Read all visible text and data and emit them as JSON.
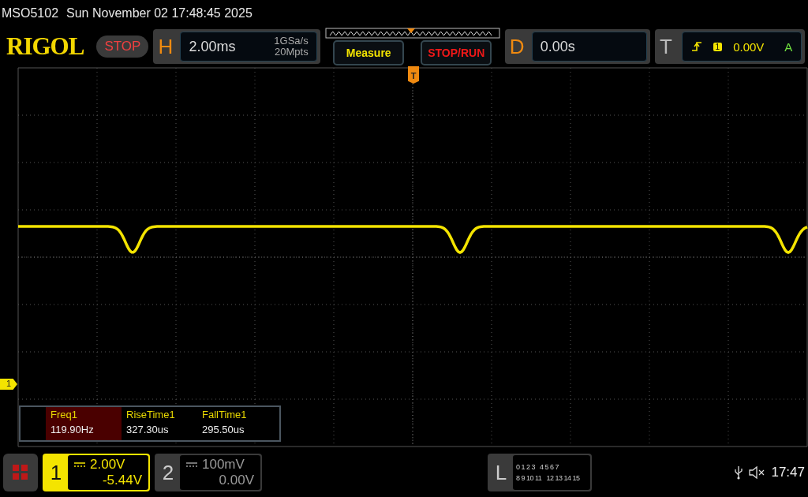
{
  "title": {
    "model": "MSO5102",
    "datetime": "Sun November 02 17:48:45 2025"
  },
  "header": {
    "logo": "RIGOL",
    "run_state": "STOP",
    "horizontal": {
      "letter": "H",
      "timebase": "2.00ms",
      "sample_rate": "1GSa/s",
      "memory_depth": "20Mpts"
    },
    "buttons": [
      {
        "label": "Measure",
        "kind": "measure"
      },
      {
        "label": "STOP/RUN",
        "kind": "stoprun"
      }
    ],
    "delay": {
      "letter": "D",
      "value": "0.00s"
    },
    "trigger": {
      "letter": "T",
      "channel": "1",
      "level": "0.00V",
      "mode": "A"
    }
  },
  "display": {
    "trigger_marker": "T",
    "channel_marker": "1"
  },
  "measurements": [
    {
      "name": "Freq1",
      "value": "119.90Hz",
      "selected": true
    },
    {
      "name": "RiseTime1",
      "value": "327.30us",
      "selected": false
    },
    {
      "name": "FallTime1",
      "value": "295.50us",
      "selected": false
    }
  ],
  "channels": [
    {
      "number": "1",
      "scale": "2.00V",
      "offset": "-5.44V",
      "on": true
    },
    {
      "number": "2",
      "scale": "100mV",
      "offset": "0.00V",
      "on": false
    }
  ],
  "logic": {
    "letter": "L",
    "rows": [
      [
        "0 1 2 3",
        "4 5 6 7"
      ],
      [
        "8 9 10 11",
        "12 13 14 15"
      ]
    ]
  },
  "status": {
    "time": "17:47"
  }
}
